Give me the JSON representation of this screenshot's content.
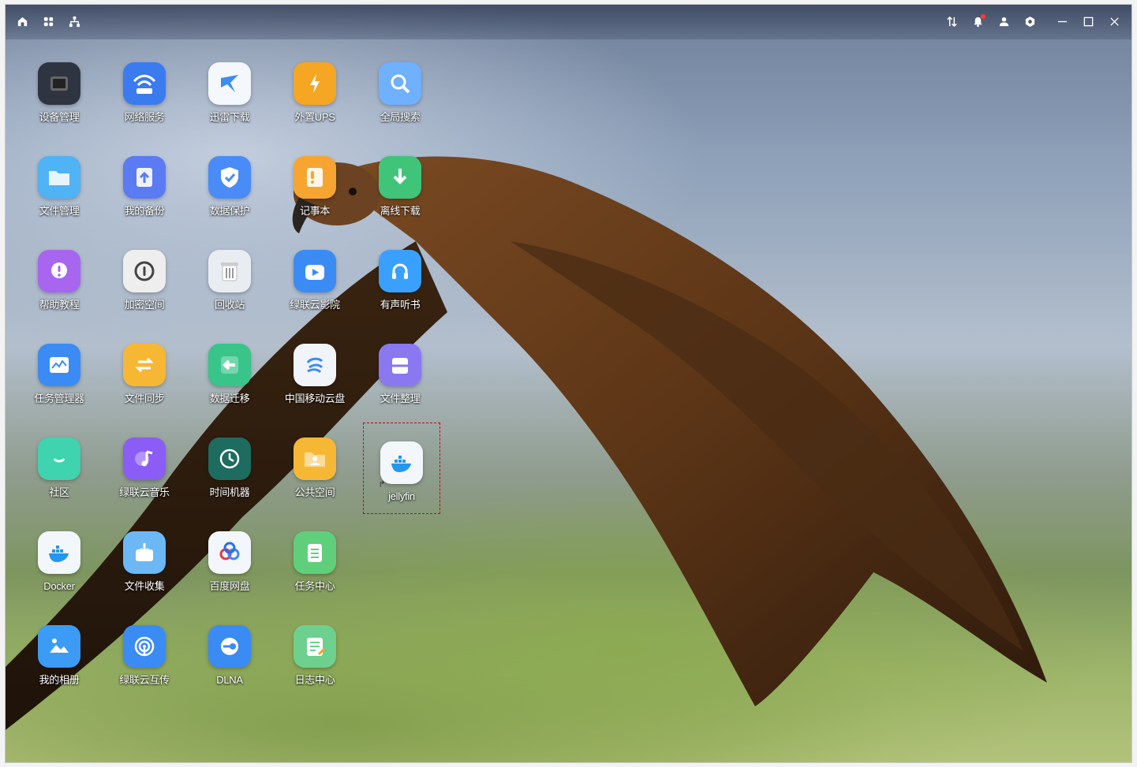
{
  "titlebar": {
    "left_icons": [
      "home-icon",
      "apps-icon",
      "network-icon"
    ],
    "right_icons": [
      "transfer-icon",
      "bell-icon",
      "user-icon",
      "settings-icon",
      "minimize-icon",
      "maximize-icon",
      "close-icon"
    ]
  },
  "apps": [
    {
      "label": "设备管理",
      "icon": "device-icon",
      "color": "#2f3540"
    },
    {
      "label": "网络服务",
      "icon": "wifi-icon",
      "color": "#3b7bf0"
    },
    {
      "label": "迅雷下载",
      "icon": "thunder-icon",
      "color": "#f4f7fb"
    },
    {
      "label": "外置UPS",
      "icon": "ups-icon",
      "color": "#f5a623"
    },
    {
      "label": "全局搜索",
      "icon": "search-icon",
      "color": "#6fb0ff"
    },
    {
      "label": "文件管理",
      "icon": "folder-icon",
      "color": "#4fb3f5"
    },
    {
      "label": "我的备份",
      "icon": "backup-icon",
      "color": "#5b7bf2"
    },
    {
      "label": "数据保护",
      "icon": "shield-icon",
      "color": "#4a8cf7"
    },
    {
      "label": "记事本",
      "icon": "notepad-icon",
      "color": "#f7a531"
    },
    {
      "label": "离线下载",
      "icon": "download-icon",
      "color": "#3fc47a"
    },
    {
      "label": "帮助教程",
      "icon": "help-icon",
      "color": "#a865f0"
    },
    {
      "label": "加密空间",
      "icon": "lock-icon",
      "color": "#eeeeee"
    },
    {
      "label": "回收站",
      "icon": "trash-icon",
      "color": "#e9edf2"
    },
    {
      "label": "绿联云影院",
      "icon": "tv-icon",
      "color": "#3b8bf5"
    },
    {
      "label": "有声听书",
      "icon": "audiobook-icon",
      "color": "#3aa0ff"
    },
    {
      "label": "任务管理器",
      "icon": "monitor-icon",
      "color": "#3b8bf5"
    },
    {
      "label": "文件同步",
      "icon": "sync-icon",
      "color": "#f6b834"
    },
    {
      "label": "数据迁移",
      "icon": "migrate-icon",
      "color": "#39c48a"
    },
    {
      "label": "中国移动云盘",
      "icon": "cloud-icon",
      "color": "#f1f4f8"
    },
    {
      "label": "文件整理",
      "icon": "organize-icon",
      "color": "#8a78f0"
    },
    {
      "label": "社区",
      "icon": "community-icon",
      "color": "#3fd3b0"
    },
    {
      "label": "绿联云音乐",
      "icon": "music-icon",
      "color": "#8b5cf6"
    },
    {
      "label": "时间机器",
      "icon": "clock-icon",
      "color": "#1e6b5f"
    },
    {
      "label": "公共空间",
      "icon": "shared-folder-icon",
      "color": "#f6b834"
    },
    {
      "label": "jellyfin",
      "icon": "docker-icon",
      "color": "#f3f6fa"
    },
    {
      "label": "Docker",
      "icon": "docker-icon",
      "color": "#f3f6fa"
    },
    {
      "label": "文件收集",
      "icon": "collect-icon",
      "color": "#6bb8f5"
    },
    {
      "label": "百度网盘",
      "icon": "baidu-icon",
      "color": "#f3f6fa"
    },
    {
      "label": "任务中心",
      "icon": "task-icon",
      "color": "#5fcf7c"
    },
    {
      "label": "我的相册",
      "icon": "photo-icon",
      "color": "#3b9bf5"
    },
    {
      "label": "绿联云互传",
      "icon": "airdrop-icon",
      "color": "#3b8bf5"
    },
    {
      "label": "DLNA",
      "icon": "dlna-icon",
      "color": "#3b8bf5"
    },
    {
      "label": "日志中心",
      "icon": "log-icon",
      "color": "#6dd08e"
    }
  ]
}
